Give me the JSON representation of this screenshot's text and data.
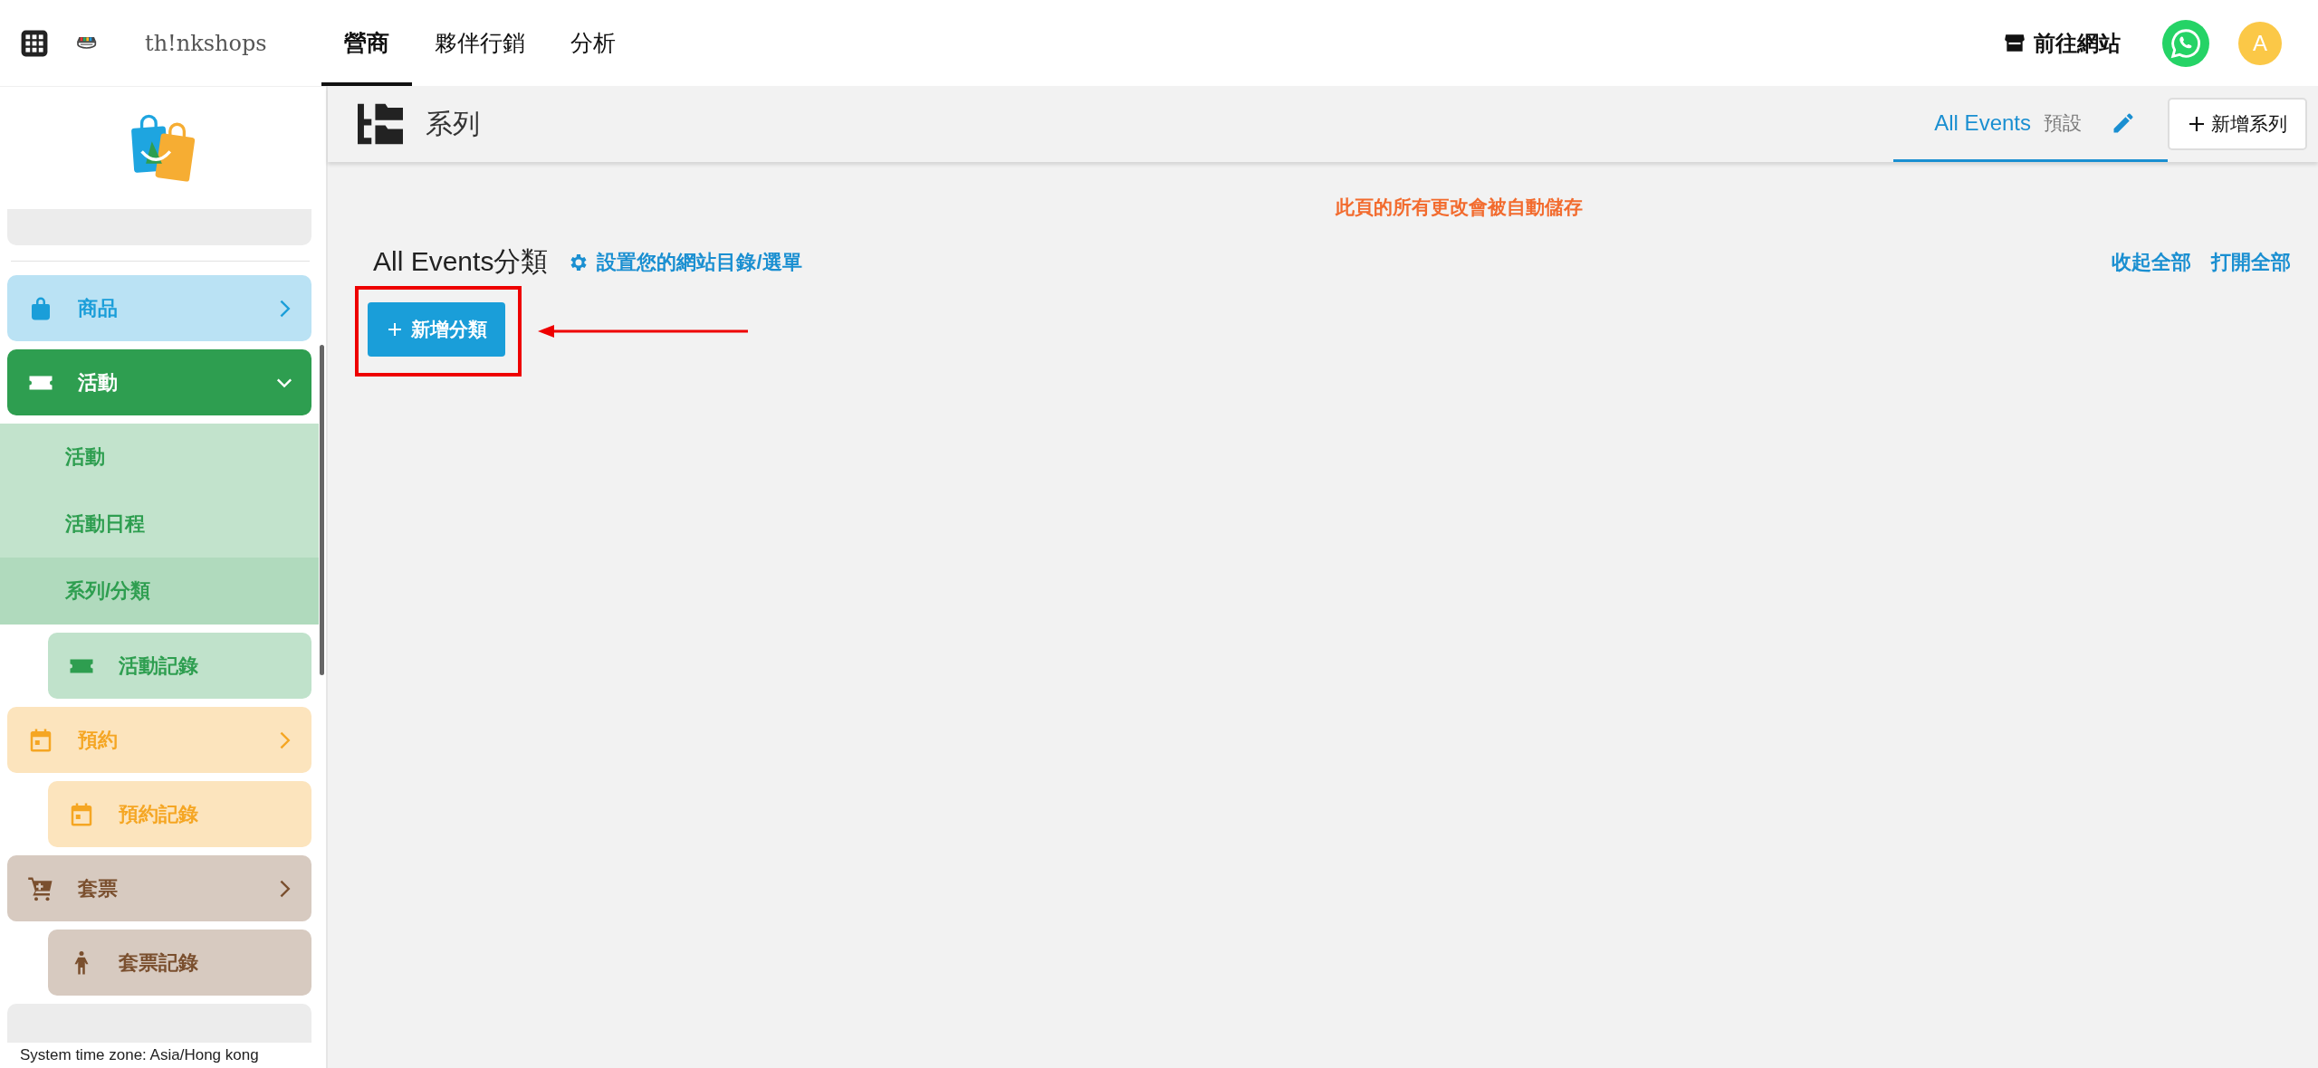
{
  "topbar": {
    "logo_text": "th!nkshops",
    "nav": [
      {
        "label": "營商",
        "selected": true
      },
      {
        "label": "夥伴行銷",
        "selected": false
      },
      {
        "label": "分析",
        "selected": false
      }
    ],
    "site_link": "前往網站",
    "avatar": "A"
  },
  "sidebar": {
    "items": [
      {
        "kind": "group",
        "label": "商品",
        "color": "#1a9ed9",
        "expanded": false
      },
      {
        "kind": "group",
        "label": "活動",
        "color": "#2e9e50",
        "expanded": true,
        "children": [
          {
            "label": "活動",
            "selected": false
          },
          {
            "label": "活動日程",
            "selected": false
          },
          {
            "label": "系列/分類",
            "selected": true
          }
        ]
      },
      {
        "kind": "subcard",
        "label": "活動記錄",
        "color": "#2e9e50"
      },
      {
        "kind": "group",
        "label": "預約",
        "color": "#f5a623",
        "expanded": false
      },
      {
        "kind": "subcard",
        "label": "預約記錄",
        "color": "#f5a623"
      },
      {
        "kind": "group",
        "label": "套票",
        "color": "#7a4f2e",
        "expanded": false
      },
      {
        "kind": "subcard",
        "label": "套票記錄",
        "color": "#7a4f2e"
      }
    ],
    "footer": "System time zone: Asia/Hong kong"
  },
  "header": {
    "title": "系列",
    "tabs": [
      {
        "label": "All Events",
        "tag": "預設",
        "selected": true
      }
    ],
    "add_series_button": "新增系列"
  },
  "content": {
    "notice": "此頁的所有更改會被自動儲存",
    "heading": "All Events分類",
    "settings_link": "設置您的網站目錄/選單",
    "collapse_all": "收起全部",
    "expand_all": "打開全部",
    "add_category_button": "新增分類"
  }
}
